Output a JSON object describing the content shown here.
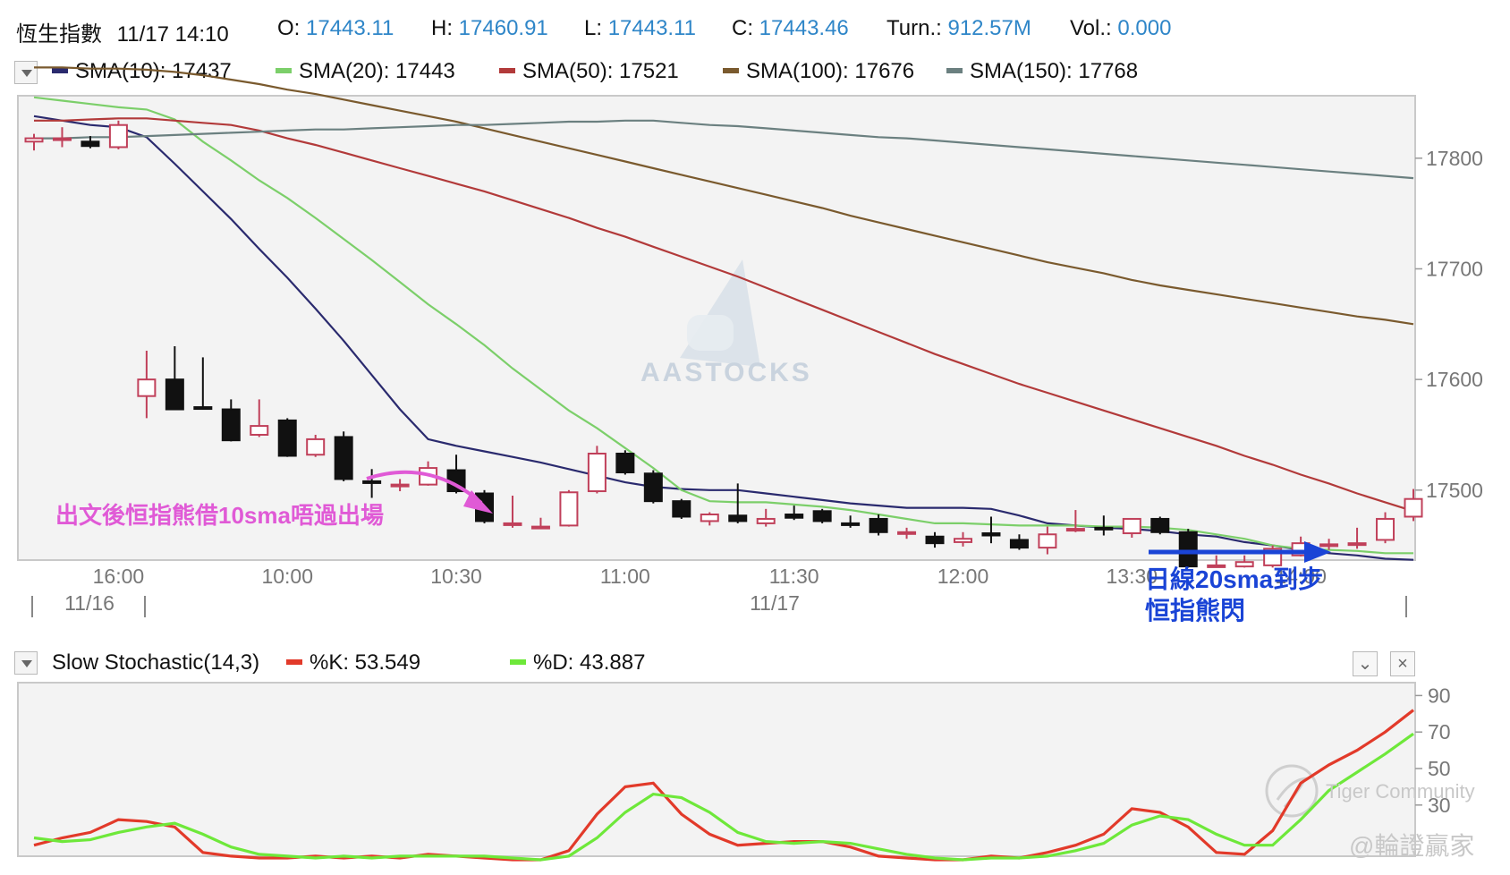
{
  "header": {
    "symbol": "恆生指數",
    "datetime": "11/17 14:10",
    "open_label": "O:",
    "open": "17443.11",
    "high_label": "H:",
    "high": "17460.91",
    "low_label": "L:",
    "low": "17443.11",
    "close_label": "C:",
    "close": "17443.46",
    "turn_label": "Turn.:",
    "turn": "912.57M",
    "vol_label": "Vol.:",
    "vol": "0.000"
  },
  "legend": {
    "sma10": "SMA(10): 17437",
    "sma20": "SMA(20): 17443",
    "sma50": "SMA(50): 17521",
    "sma100": "SMA(100): 17676",
    "sma150": "SMA(150): 17768"
  },
  "colors": {
    "sma10": "#2a2a6e",
    "sma20": "#7ccf6a",
    "sma50": "#b23a3a",
    "sma100": "#7a5a2e",
    "sma150": "#6b8080",
    "up_candle": "#c0405a",
    "down_candle": "#111111",
    "k": "#e23a2a",
    "d": "#6ee83a",
    "value": "#2f86c8"
  },
  "stoch_legend": {
    "title": "Slow Stochastic(14,3)",
    "k": "%K: 53.549",
    "d": "%D: 43.887"
  },
  "annotations": {
    "pink": "出文後恒指熊借10sma唔過出場",
    "blue_line1": "日線20sma到步",
    "blue_line2": "恒指熊閃"
  },
  "watermarks": {
    "aastocks": "AASTOCKS",
    "tiger": "Tiger Community",
    "author": "@輪證贏家"
  },
  "chart_data": [
    {
      "type": "candlestick",
      "title": "恆生指數",
      "ylim": [
        17440,
        17850
      ],
      "y_ticks": [
        17500,
        17600,
        17700,
        17800
      ],
      "x_tick_labels": [
        "16:00",
        "10:00",
        "10:30",
        "11:00",
        "11:30",
        "12:00",
        "13:30",
        "14:00"
      ],
      "date_labels": [
        "11/16",
        "11/17"
      ],
      "grid": false,
      "legend_position": "top-left",
      "candles": [
        {
          "o": 17815,
          "h": 17822,
          "l": 17807,
          "c": 17818
        },
        {
          "o": 17818,
          "h": 17828,
          "l": 17810,
          "c": 17818
        },
        {
          "o": 17815,
          "h": 17820,
          "l": 17809,
          "c": 17811
        },
        {
          "o": 17810,
          "h": 17834,
          "l": 17808,
          "c": 17830
        },
        {
          "o": 17585,
          "h": 17626,
          "l": 17565,
          "c": 17600
        },
        {
          "o": 17600,
          "h": 17630,
          "l": 17573,
          "c": 17573
        },
        {
          "o": 17575,
          "h": 17620,
          "l": 17573,
          "c": 17574
        },
        {
          "o": 17573,
          "h": 17582,
          "l": 17544,
          "c": 17545
        },
        {
          "o": 17550,
          "h": 17582,
          "l": 17548,
          "c": 17558
        },
        {
          "o": 17563,
          "h": 17565,
          "l": 17530,
          "c": 17531
        },
        {
          "o": 17532,
          "h": 17550,
          "l": 17530,
          "c": 17546
        },
        {
          "o": 17548,
          "h": 17553,
          "l": 17508,
          "c": 17510
        },
        {
          "o": 17508,
          "h": 17519,
          "l": 17493,
          "c": 17507
        },
        {
          "o": 17505,
          "h": 17510,
          "l": 17499,
          "c": 17505
        },
        {
          "o": 17505,
          "h": 17526,
          "l": 17504,
          "c": 17520
        },
        {
          "o": 17518,
          "h": 17532,
          "l": 17497,
          "c": 17499
        },
        {
          "o": 17497,
          "h": 17500,
          "l": 17470,
          "c": 17472
        },
        {
          "o": 17470,
          "h": 17495,
          "l": 17466,
          "c": 17470
        },
        {
          "o": 17467,
          "h": 17475,
          "l": 17465,
          "c": 17467
        },
        {
          "o": 17468,
          "h": 17500,
          "l": 17467,
          "c": 17498
        },
        {
          "o": 17499,
          "h": 17540,
          "l": 17497,
          "c": 17533
        },
        {
          "o": 17533,
          "h": 17536,
          "l": 17514,
          "c": 17516
        },
        {
          "o": 17515,
          "h": 17518,
          "l": 17488,
          "c": 17490
        },
        {
          "o": 17490,
          "h": 17492,
          "l": 17474,
          "c": 17476
        },
        {
          "o": 17472,
          "h": 17480,
          "l": 17468,
          "c": 17478
        },
        {
          "o": 17477,
          "h": 17506,
          "l": 17470,
          "c": 17472
        },
        {
          "o": 17470,
          "h": 17483,
          "l": 17467,
          "c": 17474
        },
        {
          "o": 17478,
          "h": 17486,
          "l": 17473,
          "c": 17475
        },
        {
          "o": 17481,
          "h": 17483,
          "l": 17470,
          "c": 17472
        },
        {
          "o": 17470,
          "h": 17477,
          "l": 17466,
          "c": 17469
        },
        {
          "o": 17474,
          "h": 17478,
          "l": 17459,
          "c": 17462
        },
        {
          "o": 17462,
          "h": 17466,
          "l": 17456,
          "c": 17462
        },
        {
          "o": 17458,
          "h": 17462,
          "l": 17448,
          "c": 17452
        },
        {
          "o": 17453,
          "h": 17462,
          "l": 17449,
          "c": 17456
        },
        {
          "o": 17461,
          "h": 17476,
          "l": 17452,
          "c": 17459
        },
        {
          "o": 17455,
          "h": 17460,
          "l": 17446,
          "c": 17448
        },
        {
          "o": 17448,
          "h": 17467,
          "l": 17442,
          "c": 17460
        },
        {
          "o": 17464,
          "h": 17482,
          "l": 17462,
          "c": 17465
        },
        {
          "o": 17466,
          "h": 17477,
          "l": 17459,
          "c": 17465
        },
        {
          "o": 17461,
          "h": 17472,
          "l": 17457,
          "c": 17474
        },
        {
          "o": 17474,
          "h": 17476,
          "l": 17460,
          "c": 17462
        },
        {
          "o": 17462,
          "h": 17465,
          "l": 17430,
          "c": 17431
        },
        {
          "o": 17431,
          "h": 17441,
          "l": 17430,
          "c": 17432
        },
        {
          "o": 17431,
          "h": 17441,
          "l": 17430,
          "c": 17435
        },
        {
          "o": 17432,
          "h": 17450,
          "l": 17430,
          "c": 17447
        },
        {
          "o": 17441,
          "h": 17458,
          "l": 17440,
          "c": 17452
        },
        {
          "o": 17450,
          "h": 17456,
          "l": 17446,
          "c": 17451
        },
        {
          "o": 17452,
          "h": 17466,
          "l": 17447,
          "c": 17452
        },
        {
          "o": 17455,
          "h": 17480,
          "l": 17452,
          "c": 17474
        },
        {
          "o": 17476,
          "h": 17501,
          "l": 17472,
          "c": 17492
        }
      ],
      "series": [
        {
          "name": "SMA(10)",
          "values": [
            17838,
            17834,
            17830,
            17828,
            17819,
            17795,
            17770,
            17745,
            17718,
            17692,
            17664,
            17635,
            17604,
            17573,
            17546,
            17540,
            17535,
            17530,
            17525,
            17519,
            17513,
            17507,
            17503,
            17501,
            17500,
            17500,
            17497,
            17494,
            17491,
            17488,
            17486,
            17484,
            17484,
            17484,
            17483,
            17477,
            17470,
            17468,
            17466,
            17465,
            17463,
            17460,
            17458,
            17453,
            17450,
            17446,
            17443,
            17441,
            17438,
            17437
          ]
        },
        {
          "name": "SMA(20)",
          "values": [
            17855,
            17852,
            17849,
            17846,
            17844,
            17835,
            17815,
            17798,
            17780,
            17764,
            17746,
            17727,
            17708,
            17688,
            17668,
            17650,
            17631,
            17610,
            17591,
            17572,
            17556,
            17538,
            17520,
            17500,
            17490,
            17489,
            17489,
            17487,
            17485,
            17482,
            17478,
            17474,
            17470,
            17470,
            17469,
            17468,
            17468,
            17468,
            17467,
            17467,
            17466,
            17464,
            17460,
            17456,
            17450,
            17447,
            17446,
            17445,
            17443,
            17443
          ]
        },
        {
          "name": "SMA(50)",
          "values": [
            17834,
            17834,
            17835,
            17836,
            17836,
            17834,
            17832,
            17830,
            17825,
            17818,
            17812,
            17805,
            17798,
            17791,
            17784,
            17777,
            17770,
            17762,
            17754,
            17746,
            17737,
            17729,
            17720,
            17711,
            17702,
            17693,
            17683,
            17673,
            17663,
            17653,
            17643,
            17633,
            17623,
            17614,
            17605,
            17596,
            17588,
            17580,
            17572,
            17564,
            17556,
            17548,
            17540,
            17531,
            17523,
            17514,
            17506,
            17497,
            17489,
            17481
          ]
        },
        {
          "name": "SMA(100)",
          "values": [
            17882,
            17882,
            17881,
            17881,
            17880,
            17878,
            17875,
            17871,
            17867,
            17862,
            17858,
            17853,
            17848,
            17843,
            17838,
            17833,
            17827,
            17821,
            17815,
            17809,
            17803,
            17797,
            17791,
            17785,
            17779,
            17773,
            17767,
            17761,
            17755,
            17748,
            17742,
            17736,
            17730,
            17724,
            17718,
            17712,
            17706,
            17701,
            17696,
            17690,
            17685,
            17681,
            17677,
            17673,
            17669,
            17665,
            17661,
            17657,
            17654,
            17650
          ]
        },
        {
          "name": "SMA(150)",
          "values": [
            17818,
            17818,
            17819,
            17819,
            17820,
            17821,
            17822,
            17823,
            17824,
            17825,
            17826,
            17826,
            17827,
            17828,
            17829,
            17830,
            17830,
            17831,
            17832,
            17833,
            17833,
            17834,
            17834,
            17832,
            17830,
            17829,
            17827,
            17825,
            17823,
            17821,
            17819,
            17818,
            17816,
            17814,
            17812,
            17810,
            17808,
            17806,
            17804,
            17802,
            17800,
            17798,
            17796,
            17794,
            17792,
            17790,
            17788,
            17786,
            17784,
            17782
          ]
        }
      ]
    },
    {
      "type": "line",
      "title": "Slow Stochastic(14,3)",
      "ylim": [
        0,
        100
      ],
      "y_ticks": [
        30,
        50,
        70,
        90
      ],
      "grid": false,
      "legend_position": "top-left",
      "series": [
        {
          "name": "%K",
          "values": [
            8,
            12,
            15,
            22,
            21,
            18,
            4,
            2,
            1,
            1,
            2,
            1,
            2,
            1,
            3,
            2,
            1,
            0,
            0,
            5,
            25,
            40,
            42,
            25,
            14,
            8,
            9,
            10,
            10,
            7,
            2,
            1,
            0,
            0,
            2,
            1,
            4,
            8,
            14,
            28,
            26,
            18,
            4,
            3,
            16,
            42,
            52,
            60,
            70,
            82
          ]
        },
        {
          "name": "%D",
          "values": [
            12,
            10,
            11,
            15,
            18,
            20,
            14,
            7,
            3,
            2,
            1,
            2,
            1,
            2,
            2,
            2,
            2,
            1,
            0,
            2,
            12,
            26,
            36,
            34,
            26,
            15,
            10,
            9,
            10,
            9,
            6,
            3,
            1,
            0,
            1,
            1,
            2,
            5,
            9,
            19,
            24,
            22,
            14,
            8,
            8,
            22,
            38,
            48,
            58,
            69
          ]
        }
      ]
    }
  ]
}
